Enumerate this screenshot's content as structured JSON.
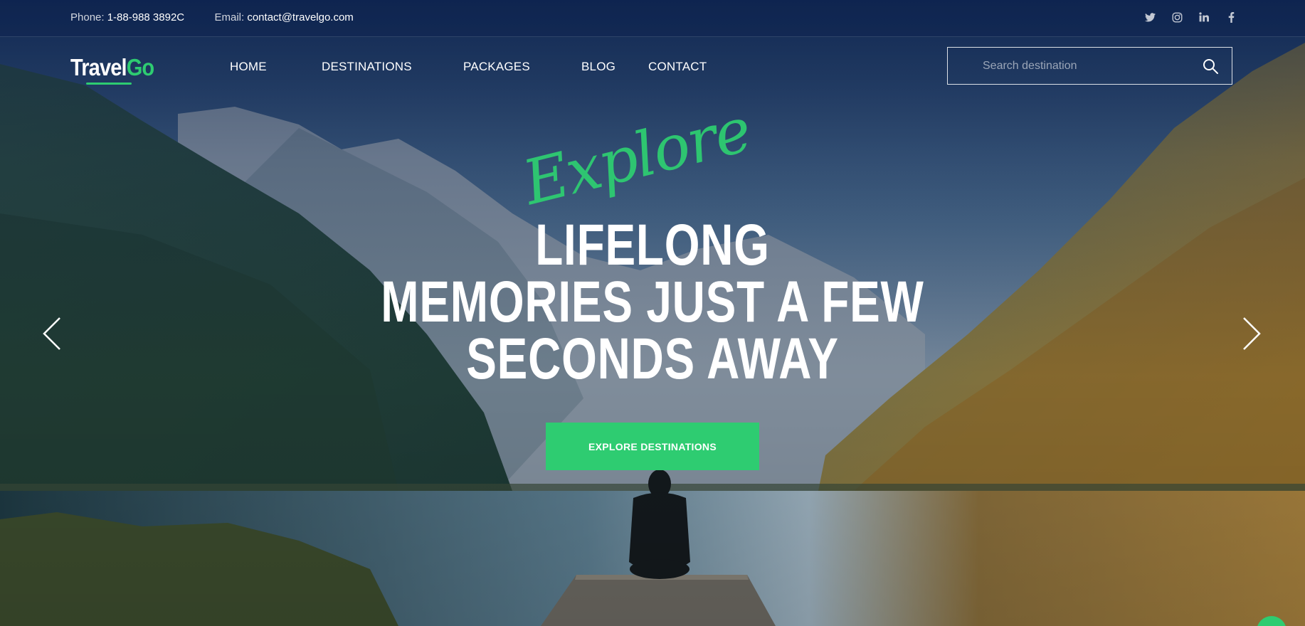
{
  "topbar": {
    "phone_label": "Phone:",
    "phone_value": "1-88-988 3892C",
    "email_label": "Email:",
    "email_value": "contact@travelgo.com",
    "socials": [
      "twitter-icon",
      "instagram-icon",
      "linkedin-icon",
      "facebook-icon"
    ]
  },
  "brand": {
    "part1": "Travel",
    "part2": "Go",
    "accent_color": "#2ecc71"
  },
  "nav": {
    "items": [
      "HOME",
      "DESTINATIONS",
      "PACKAGES",
      "BLOG",
      "CONTACT"
    ]
  },
  "search": {
    "placeholder": "Search destination"
  },
  "hero": {
    "script": "Explore",
    "line1": "LIFELONG",
    "line2": "MEMORIES JUST A FEW",
    "line3": "SECONDS AWAY",
    "cta_label": "EXPLORE DESTINATIONS"
  }
}
